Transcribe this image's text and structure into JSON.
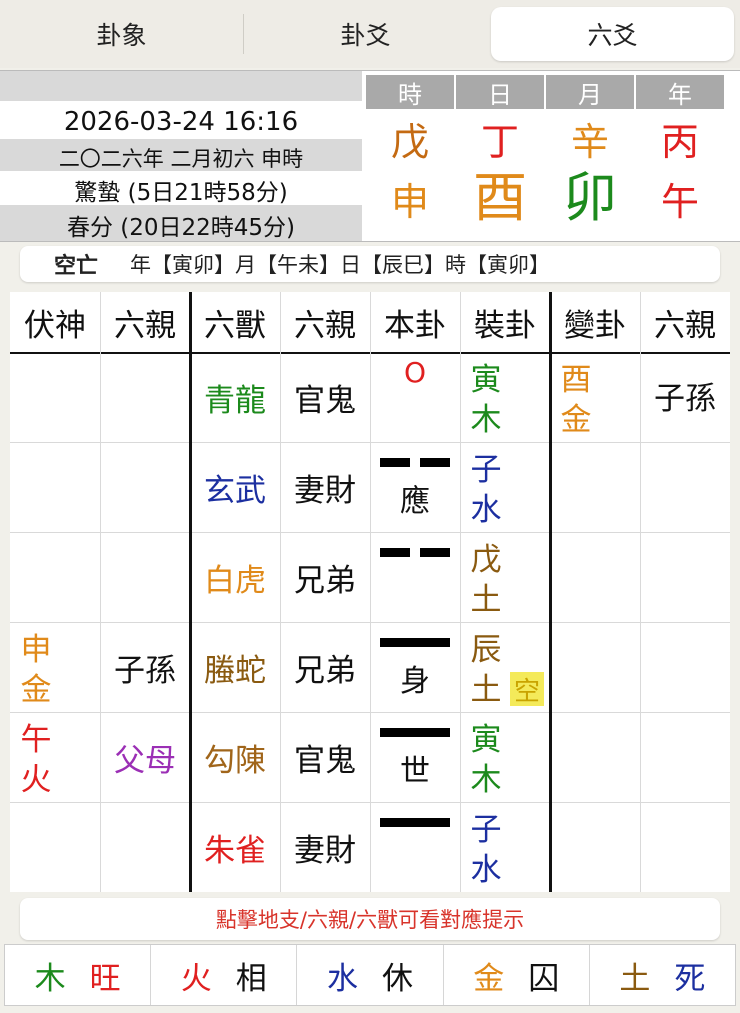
{
  "tabs": [
    {
      "label": "卦象"
    },
    {
      "label": "卦爻"
    },
    {
      "label": "六爻"
    }
  ],
  "info": {
    "datetime": "2026-03-24 16:16",
    "lunar": "二〇二六年 二月初六 申時",
    "term1": "驚蟄 (5日21時58分)",
    "term2": "春分 (20日22時45分)"
  },
  "ganzhi": {
    "headers": [
      "時",
      "日",
      "月",
      "年"
    ],
    "stems": [
      {
        "char": "戊",
        "color": "#c46a12"
      },
      {
        "char": "丁",
        "color": "#e02020"
      },
      {
        "char": "辛",
        "color": "#e08a1a"
      },
      {
        "char": "丙",
        "color": "#e02020"
      }
    ],
    "branches": [
      {
        "char": "申",
        "color": "#e08a1a"
      },
      {
        "char": "酉",
        "color": "#e08a1a"
      },
      {
        "char": "卯",
        "color": "#1c8a1c"
      },
      {
        "char": "午",
        "color": "#e02020"
      }
    ]
  },
  "kongwang": {
    "label": "空亡",
    "text": "年【寅卯】月【午未】日【辰巳】時【寅卯】"
  },
  "table": {
    "headers": [
      "伏神",
      "六親",
      "六獸",
      "六親",
      "本卦",
      "裝卦",
      "變卦",
      "六親"
    ],
    "rows": [
      {
        "fushen": [],
        "fushen_liuqin": {
          "text": "",
          "color": "#111"
        },
        "liushou": {
          "text": "青龍",
          "color": "#1c8a1c"
        },
        "liuqin": "官鬼",
        "yao": "moving-yang",
        "yao_mark": "O",
        "yao_mark_color": "#e02020",
        "yao_label": "",
        "zhuang": [
          {
            "text": "寅",
            "color": "#1c8a1c"
          },
          {
            "text": "木",
            "color": "#1c8a1c"
          }
        ],
        "bian": [
          {
            "text": "酉",
            "color": "#e08a1a"
          },
          {
            "text": "金",
            "color": "#e08a1a"
          }
        ],
        "bian_liuqin": "子孫",
        "kong": ""
      },
      {
        "fushen": [],
        "fushen_liuqin": {
          "text": "",
          "color": "#111"
        },
        "liushou": {
          "text": "玄武",
          "color": "#1c2fa0"
        },
        "liuqin": "妻財",
        "yao": "yin",
        "yao_mark": "",
        "yao_mark_color": "#111",
        "yao_label": "應",
        "zhuang": [
          {
            "text": "子",
            "color": "#1c2fa0"
          },
          {
            "text": "水",
            "color": "#1c2fa0"
          }
        ],
        "bian": [],
        "bian_liuqin": "",
        "kong": ""
      },
      {
        "fushen": [],
        "fushen_liuqin": {
          "text": "",
          "color": "#111"
        },
        "liushou": {
          "text": "白虎",
          "color": "#e08a1a"
        },
        "liuqin": "兄弟",
        "yao": "yin",
        "yao_mark": "",
        "yao_mark_color": "#111",
        "yao_label": "",
        "zhuang": [
          {
            "text": "戊",
            "color": "#8a5a10"
          },
          {
            "text": "土",
            "color": "#8a5a10"
          }
        ],
        "bian": [],
        "bian_liuqin": "",
        "kong": ""
      },
      {
        "fushen": [
          {
            "text": "申",
            "color": "#e08a1a"
          },
          {
            "text": "金",
            "color": "#e08a1a"
          }
        ],
        "fushen_liuqin": {
          "text": "子孫",
          "color": "#111"
        },
        "liushou": {
          "text": "螣蛇",
          "color": "#8a5a10"
        },
        "liuqin": "兄弟",
        "yao": "yang",
        "yao_mark": "",
        "yao_mark_color": "#111",
        "yao_label": "身",
        "zhuang": [
          {
            "text": "辰",
            "color": "#8a5a10"
          },
          {
            "text": "土",
            "color": "#8a5a10"
          }
        ],
        "bian": [],
        "bian_liuqin": "",
        "kong": "空"
      },
      {
        "fushen": [
          {
            "text": "午",
            "color": "#e02020"
          },
          {
            "text": "火",
            "color": "#e02020"
          }
        ],
        "fushen_liuqin": {
          "text": "父母",
          "color": "#9b2fb5"
        },
        "liushou": {
          "text": "勾陳",
          "color": "#a0651a"
        },
        "liuqin": "官鬼",
        "yao": "yang",
        "yao_mark": "",
        "yao_mark_color": "#111",
        "yao_label": "世",
        "zhuang": [
          {
            "text": "寅",
            "color": "#1c8a1c"
          },
          {
            "text": "木",
            "color": "#1c8a1c"
          }
        ],
        "bian": [],
        "bian_liuqin": "",
        "kong": ""
      },
      {
        "fushen": [],
        "fushen_liuqin": {
          "text": "",
          "color": "#111"
        },
        "liushou": {
          "text": "朱雀",
          "color": "#e02020"
        },
        "liuqin": "妻財",
        "yao": "yang",
        "yao_mark": "",
        "yao_mark_color": "#111",
        "yao_label": "",
        "zhuang": [
          {
            "text": "子",
            "color": "#1c2fa0"
          },
          {
            "text": "水",
            "color": "#1c2fa0"
          }
        ],
        "bian": [],
        "bian_liuqin": "",
        "kong": ""
      }
    ]
  },
  "hint": "點擊地支/六親/六獸可看對應提示",
  "wuxing": [
    {
      "element": "木",
      "state": "旺",
      "color": "#1c8a1c",
      "state_color": "#e02020"
    },
    {
      "element": "火",
      "state": "相",
      "color": "#e02020",
      "state_color": "#111"
    },
    {
      "element": "水",
      "state": "休",
      "color": "#1c2fa0",
      "state_color": "#111"
    },
    {
      "element": "金",
      "state": "囚",
      "color": "#e08a1a",
      "state_color": "#111"
    },
    {
      "element": "土",
      "state": "死",
      "color": "#8a5a10",
      "state_color": "#1c2fa0"
    }
  ]
}
